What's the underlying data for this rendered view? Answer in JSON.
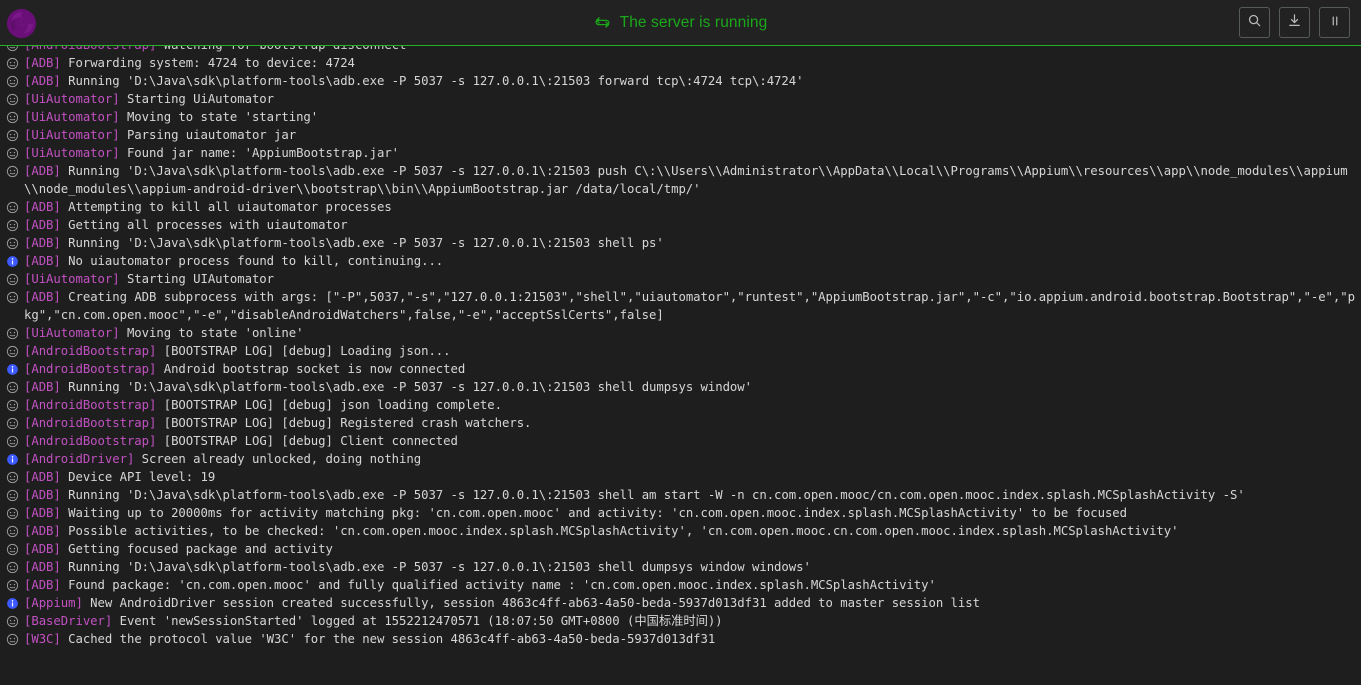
{
  "header": {
    "logo_name": "appium-logo",
    "status_icon": "sync-icon",
    "status_text": "The server is running",
    "status_color": "#1aa81a",
    "actions": [
      {
        "name": "search-button",
        "icon": "search-icon",
        "label": "Search"
      },
      {
        "name": "download-button",
        "icon": "download-icon",
        "label": "Save Logs"
      },
      {
        "name": "pause-button",
        "icon": "pause-icon",
        "label": "Pause"
      }
    ]
  },
  "theme": {
    "background": "#1e1e1e",
    "header_background": "#222222",
    "tag_color": "#c251c2",
    "message_color": "#d6d6d6",
    "info_icon_color": "#3d5afe",
    "debug_icon_color": "#9b9b9b",
    "accent_green": "#24b324",
    "logo_purple": "#6b0f78"
  },
  "log": {
    "lines": [
      {
        "level": "debug",
        "tag": "[AndroidBootstrap]",
        "message": " Watching for bootstrap disconnect",
        "clipped_top": true
      },
      {
        "level": "debug",
        "tag": "[ADB]",
        "message": " Forwarding system: 4724 to device: 4724"
      },
      {
        "level": "debug",
        "tag": "[ADB]",
        "message": " Running 'D:\\Java\\sdk\\platform-tools\\adb.exe -P 5037 -s 127.0.0.1\\:21503 forward tcp\\:4724 tcp\\:4724'"
      },
      {
        "level": "debug",
        "tag": "[UiAutomator]",
        "message": " Starting UiAutomator"
      },
      {
        "level": "debug",
        "tag": "[UiAutomator]",
        "message": " Moving to state 'starting'"
      },
      {
        "level": "debug",
        "tag": "[UiAutomator]",
        "message": " Parsing uiautomator jar"
      },
      {
        "level": "debug",
        "tag": "[UiAutomator]",
        "message": " Found jar name: 'AppiumBootstrap.jar'"
      },
      {
        "level": "debug",
        "tag": "[ADB]",
        "message": " Running 'D:\\Java\\sdk\\platform-tools\\adb.exe -P 5037 -s 127.0.0.1\\:21503 push C\\:\\\\Users\\\\Administrator\\\\AppData\\\\Local\\\\Programs\\\\Appium\\\\resources\\\\app\\\\node_modules\\\\appium\\\\node_modules\\\\appium-android-driver\\\\bootstrap\\\\bin\\\\AppiumBootstrap.jar /data/local/tmp/'"
      },
      {
        "level": "debug",
        "tag": "[ADB]",
        "message": " Attempting to kill all uiautomator processes"
      },
      {
        "level": "debug",
        "tag": "[ADB]",
        "message": " Getting all processes with uiautomator"
      },
      {
        "level": "debug",
        "tag": "[ADB]",
        "message": " Running 'D:\\Java\\sdk\\platform-tools\\adb.exe -P 5037 -s 127.0.0.1\\:21503 shell ps'"
      },
      {
        "level": "info",
        "tag": "[ADB]",
        "message": " No uiautomator process found to kill, continuing..."
      },
      {
        "level": "debug",
        "tag": "[UiAutomator]",
        "message": " Starting UIAutomator"
      },
      {
        "level": "debug",
        "tag": "[ADB]",
        "message": " Creating ADB subprocess with args: [\"-P\",5037,\"-s\",\"127.0.0.1:21503\",\"shell\",\"uiautomator\",\"runtest\",\"AppiumBootstrap.jar\",\"-c\",\"io.appium.android.bootstrap.Bootstrap\",\"-e\",\"pkg\",\"cn.com.open.mooc\",\"-e\",\"disableAndroidWatchers\",false,\"-e\",\"acceptSslCerts\",false]"
      },
      {
        "level": "debug",
        "tag": "[UiAutomator]",
        "message": " Moving to state 'online'"
      },
      {
        "level": "debug",
        "tag": "[AndroidBootstrap]",
        "message": " [BOOTSTRAP LOG] [debug] Loading json..."
      },
      {
        "level": "info",
        "tag": "[AndroidBootstrap]",
        "message": " Android bootstrap socket is now connected"
      },
      {
        "level": "debug",
        "tag": "[ADB]",
        "message": " Running 'D:\\Java\\sdk\\platform-tools\\adb.exe -P 5037 -s 127.0.0.1\\:21503 shell dumpsys window'"
      },
      {
        "level": "debug",
        "tag": "[AndroidBootstrap]",
        "message": " [BOOTSTRAP LOG] [debug] json loading complete."
      },
      {
        "level": "debug",
        "tag": "[AndroidBootstrap]",
        "message": " [BOOTSTRAP LOG] [debug] Registered crash watchers."
      },
      {
        "level": "debug",
        "tag": "[AndroidBootstrap]",
        "message": " [BOOTSTRAP LOG] [debug] Client connected"
      },
      {
        "level": "info",
        "tag": "[AndroidDriver]",
        "message": " Screen already unlocked, doing nothing"
      },
      {
        "level": "debug",
        "tag": "[ADB]",
        "message": " Device API level: 19"
      },
      {
        "level": "debug",
        "tag": "[ADB]",
        "message": " Running 'D:\\Java\\sdk\\platform-tools\\adb.exe -P 5037 -s 127.0.0.1\\:21503 shell am start -W -n cn.com.open.mooc/cn.com.open.mooc.index.splash.MCSplashActivity -S'"
      },
      {
        "level": "debug",
        "tag": "[ADB]",
        "message": " Waiting up to 20000ms for activity matching pkg: 'cn.com.open.mooc' and activity: 'cn.com.open.mooc.index.splash.MCSplashActivity' to be focused"
      },
      {
        "level": "debug",
        "tag": "[ADB]",
        "message": " Possible activities, to be checked: 'cn.com.open.mooc.index.splash.MCSplashActivity', 'cn.com.open.mooc.cn.com.open.mooc.index.splash.MCSplashActivity'"
      },
      {
        "level": "debug",
        "tag": "[ADB]",
        "message": " Getting focused package and activity"
      },
      {
        "level": "debug",
        "tag": "[ADB]",
        "message": " Running 'D:\\Java\\sdk\\platform-tools\\adb.exe -P 5037 -s 127.0.0.1\\:21503 shell dumpsys window windows'"
      },
      {
        "level": "debug",
        "tag": "[ADB]",
        "message": " Found package: 'cn.com.open.mooc' and fully qualified activity name : 'cn.com.open.mooc.index.splash.MCSplashActivity'"
      },
      {
        "level": "info",
        "tag": "[Appium]",
        "message": " New AndroidDriver session created successfully, session 4863c4ff-ab63-4a50-beda-5937d013df31 added to master session list"
      },
      {
        "level": "debug",
        "tag": "[BaseDriver]",
        "message": " Event 'newSessionStarted' logged at 1552212470571 (18:07:50 GMT+0800 (中国标准时间))"
      },
      {
        "level": "debug",
        "tag": "[W3C]",
        "message": " Cached the protocol value 'W3C' for the new session 4863c4ff-ab63-4a50-beda-5937d013df31"
      }
    ]
  }
}
